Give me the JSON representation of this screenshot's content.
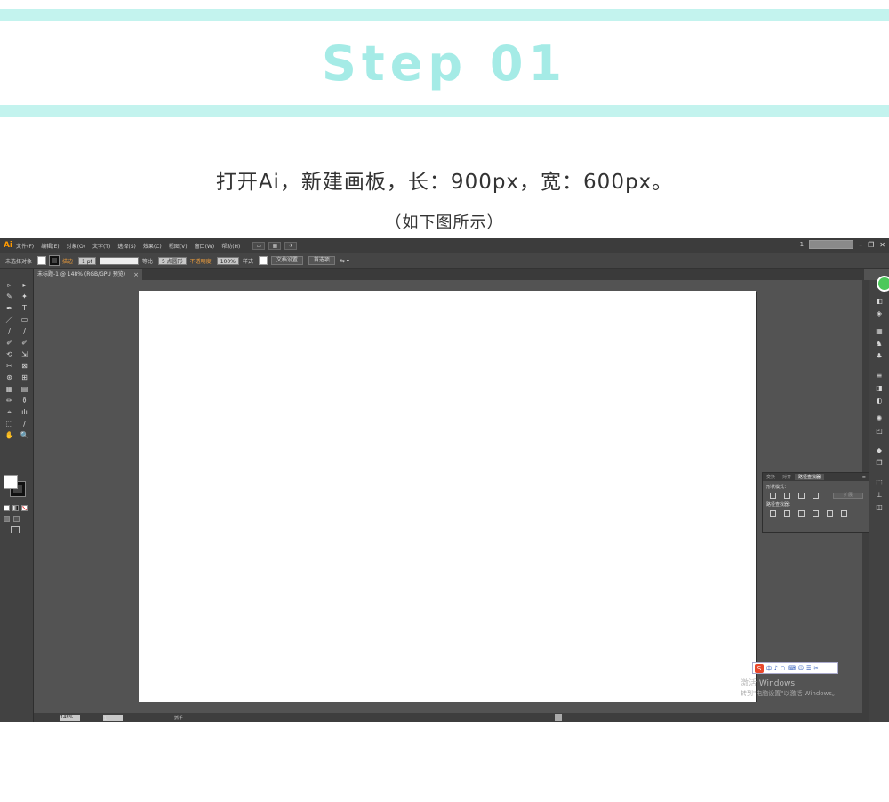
{
  "header": {
    "title": "Step 01",
    "instruction": "打开Ai，新建画板，长：900px，宽：600px。",
    "subtitle": "（如下图所示）"
  },
  "colors": {
    "accent": "#c3f3ee",
    "title": "#a5ebe6",
    "ai_logo": "#ff9a00",
    "canvas_bg": "#535353"
  },
  "ai": {
    "logo": "Ai",
    "menu": [
      "文件(F)",
      "编辑(E)",
      "对象(O)",
      "文字(T)",
      "选择(S)",
      "效果(C)",
      "视图(V)",
      "窗口(W)",
      "帮助(H)"
    ],
    "workspace_num": "1",
    "window_controls": [
      "–",
      "❐",
      "✕"
    ],
    "control_bar": {
      "no_selection": "未选择对象",
      "stroke_label": "描边",
      "stroke_value": "1 pt",
      "stroke_style": "等比",
      "brush": "5 点圆形",
      "opacity_label": "不透明度",
      "opacity_value": "100%",
      "style_label": "样式",
      "doc_setup": "文档设置",
      "prefs": "首选项"
    },
    "doc_tab": "未标题-1 @ 148% (RGB/GPU 预览)",
    "tab_close": "×",
    "status": {
      "zoom": "148%",
      "page": "1",
      "tool": "抓手"
    },
    "tools": [
      "▹",
      "▸",
      "✎",
      "✦",
      "✒",
      "T",
      "／",
      "▭",
      "∕",
      "∕",
      "✐",
      "✐",
      "⟲",
      "⇲",
      "✂",
      "⊠",
      "⊛",
      "⊞",
      "▦",
      "▤",
      "✏",
      "⚱",
      "⌖",
      "ılı",
      "⬚",
      "∕",
      "✋",
      "🔍"
    ],
    "pathfinder": {
      "tabs": [
        "变换",
        "对齐",
        "路径查找器"
      ],
      "active_tab": "路径查找器",
      "shape_modes": "形状模式：",
      "expand": "扩展",
      "pathfinders": "路径查找器："
    },
    "ime": {
      "logo": "S",
      "items": [
        "中",
        "♪",
        "○",
        "⌨",
        "☺",
        "☰",
        "✂"
      ]
    },
    "activate": {
      "title": "激活 Windows",
      "subtitle": "转到\"电脑设置\"以激活 Windows。"
    }
  }
}
